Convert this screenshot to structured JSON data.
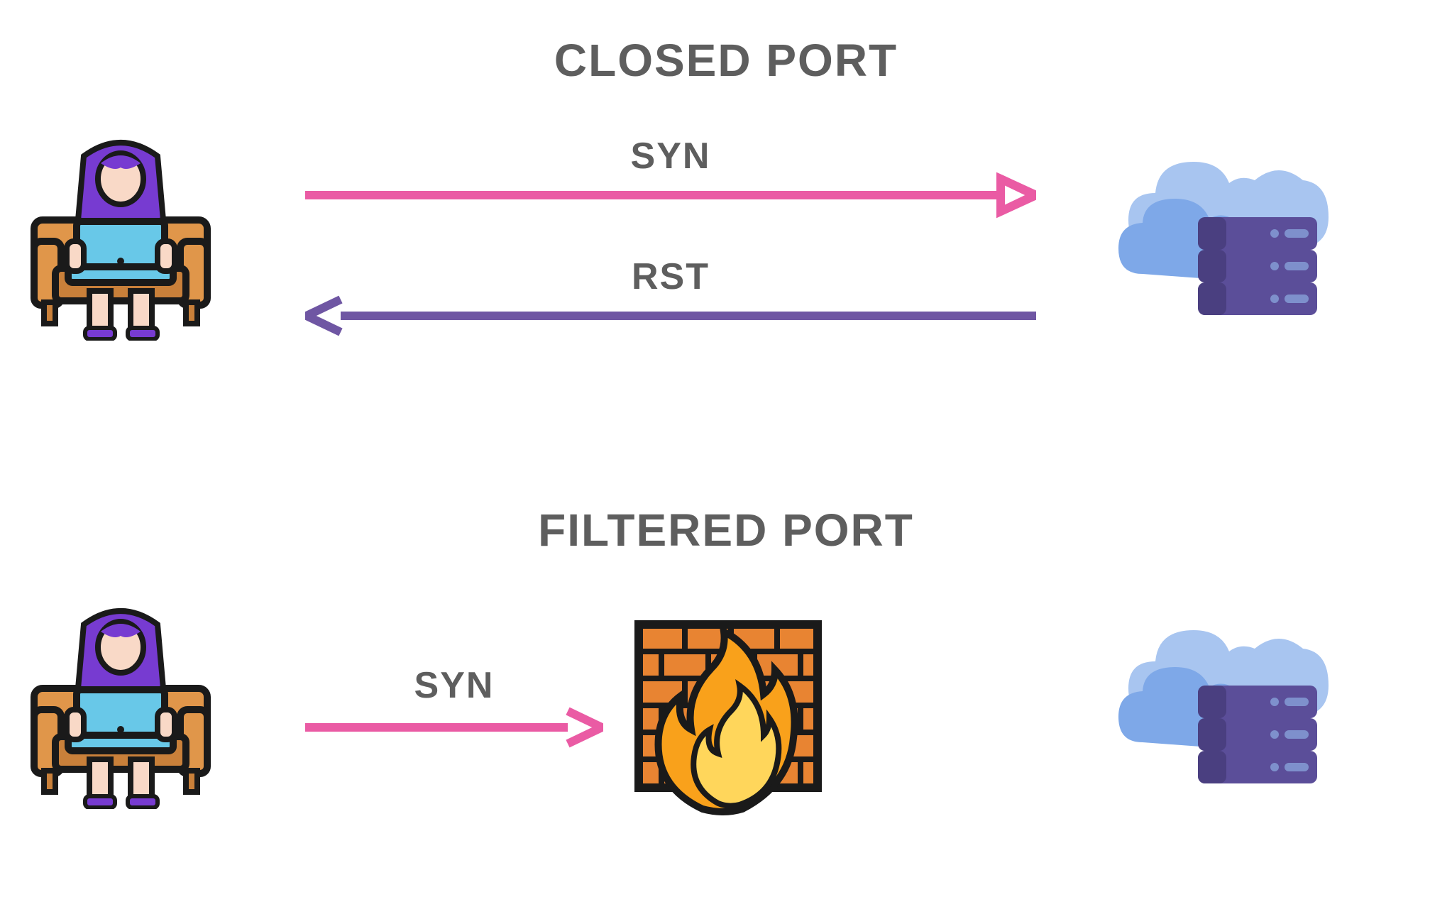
{
  "sections": {
    "closed": {
      "title": "CLOSED PORT",
      "arrow_syn": "SYN",
      "arrow_rst": "RST"
    },
    "filtered": {
      "title": "FILTERED PORT",
      "arrow_syn": "SYN"
    }
  },
  "colors": {
    "syn_arrow": "#ea5ba4",
    "rst_arrow": "#6f56a3",
    "text": "#5e5e5e",
    "skin": "#f9d9c7",
    "hair": "#773bd1",
    "shirt": "#a83f8e",
    "laptop_body": "#68c8e8",
    "couch": "#e0964a",
    "couch_shadow": "#c9803a",
    "server": "#5b4e99",
    "server_light": "#7e90cc",
    "cloud_back": "#a8c5f0",
    "cloud_front": "#7ea8e8",
    "brick_fill": "#e88432",
    "brick_line": "#1a1a1a",
    "flame_outer": "#f9a11b",
    "flame_inner": "#ffd65b",
    "outline": "#1a1a1a"
  },
  "icons": {
    "client": "user-on-couch-with-laptop",
    "server": "cloud-server-stack",
    "firewall": "brick-wall-with-flame"
  }
}
